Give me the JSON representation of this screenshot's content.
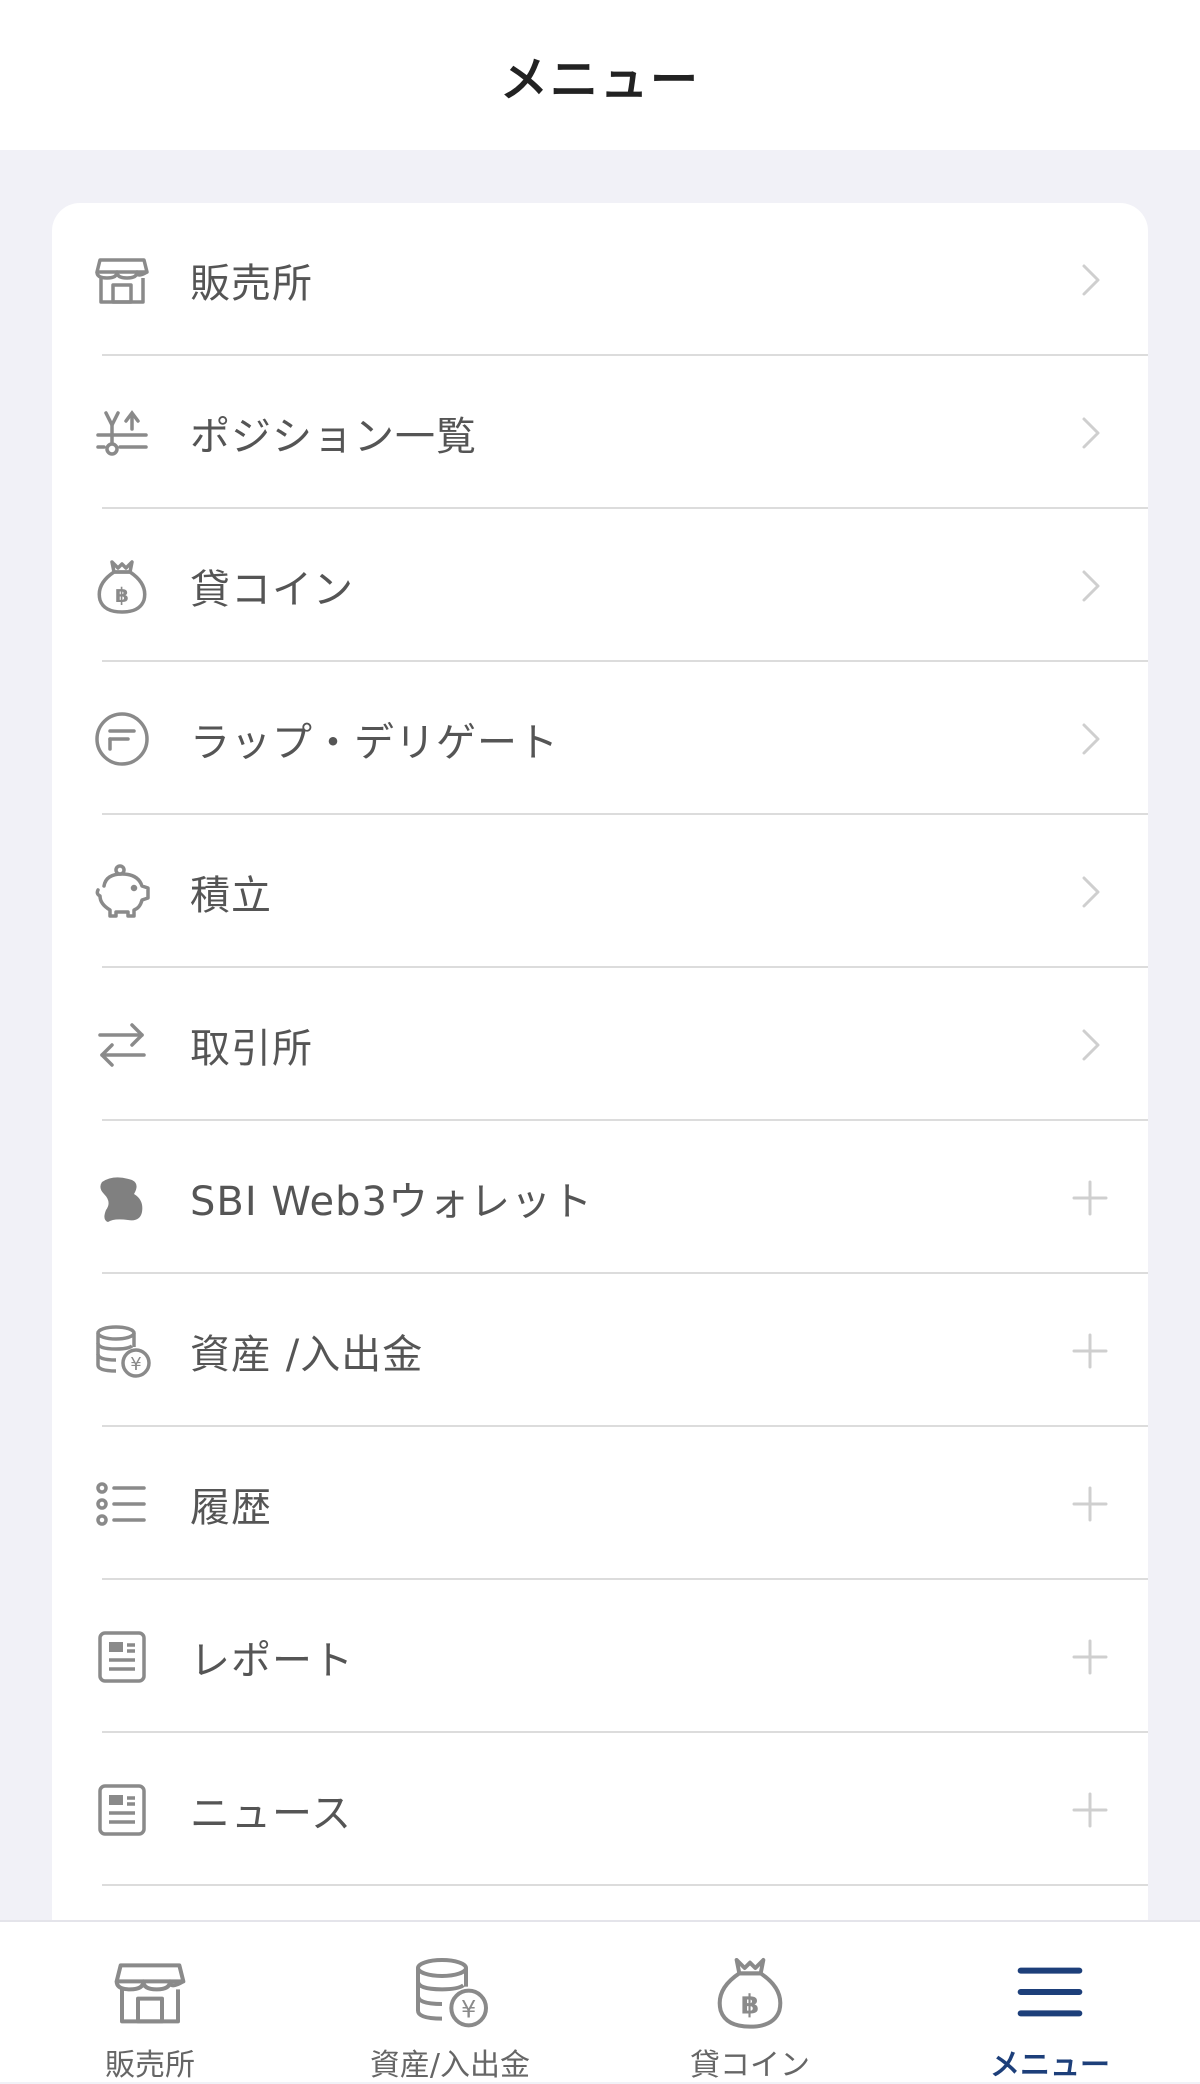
{
  "header": {
    "title": "メニュー"
  },
  "menu": {
    "items": [
      {
        "label": "販売所",
        "icon": "store-icon",
        "trail": "chevron"
      },
      {
        "label": "ポジション一覧",
        "icon": "sliders-icon",
        "trail": "chevron"
      },
      {
        "label": "貸コイン",
        "icon": "coin-bag-icon",
        "trail": "chevron"
      },
      {
        "label": "ラップ・デリゲート",
        "icon": "wrap-icon",
        "trail": "chevron"
      },
      {
        "label": "積立",
        "icon": "piggy-bank-icon",
        "trail": "chevron"
      },
      {
        "label": "取引所",
        "icon": "exchange-arrows-icon",
        "trail": "chevron"
      },
      {
        "label": "SBI Web3ウォレット",
        "icon": "wallet-logo-icon",
        "trail": "plus"
      },
      {
        "label": "資産 /入出金",
        "icon": "coins-yen-icon",
        "trail": "plus"
      },
      {
        "label": "履歴",
        "icon": "list-icon",
        "trail": "plus"
      },
      {
        "label": "レポート",
        "icon": "document-icon",
        "trail": "plus"
      },
      {
        "label": "ニュース",
        "icon": "news-icon",
        "trail": "plus"
      }
    ]
  },
  "tabbar": {
    "tabs": [
      {
        "label": "販売所",
        "icon": "store-icon",
        "active": false
      },
      {
        "label": "資産/入出金",
        "icon": "coins-yen-icon",
        "active": false
      },
      {
        "label": "貸コイン",
        "icon": "coin-bag-icon",
        "active": false
      },
      {
        "label": "メニュー",
        "icon": "hamburger-menu-icon",
        "active": true
      }
    ]
  },
  "colors": {
    "background": "#f1f1f7",
    "active_tab": "#1d3f7a",
    "icon_gray": "#8a8a8a"
  }
}
